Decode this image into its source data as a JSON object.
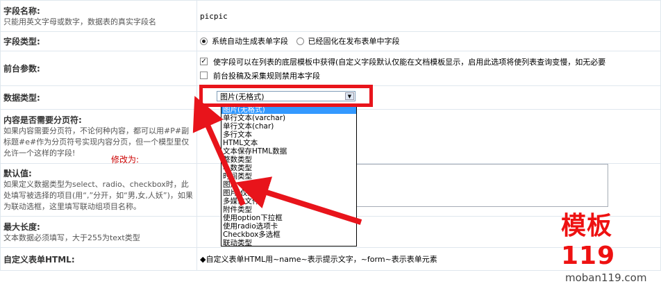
{
  "rows": {
    "field_name": {
      "label": "字段名称:",
      "hint": "只能用英文字母或数字，数据表的真实字段名",
      "value": "picpic"
    },
    "field_type": {
      "label": "字段类型:",
      "option1": "系统自动生成表单字段",
      "option2": "已经固化在发布表单中字段"
    },
    "front_params": {
      "label": "前台参数:",
      "check1": "使字段可以在列表的底层模板中获得(自定义字段默认仅能在文档模板显示，启用此选项将使列表查询变慢，如无必要",
      "check2": "前台投稿及采集规则禁用本字段"
    },
    "data_type": {
      "label": "数据类型:",
      "selected": "图片(无格式)"
    },
    "paging": {
      "label": "内容是否需要分页符:",
      "hint": "如果内容需要分页符，不论何种内容，都可以用#P#副标题#e#作为分页符号实现内容分页，但一个模型里仅允许一个这样的字段!"
    },
    "default": {
      "label": "默认值:",
      "hint": "如果定义数据类型为select、radio、checkbox时，此处填写被选择的项目(用“,”分开，如“男,女,人妖”)，如果为联动选框，这里填写联动组项目名称。"
    },
    "max_length": {
      "label": "最大长度:",
      "hint": "文本数据必须填写，大于255为text类型"
    },
    "custom_html": {
      "label": "自定义表单HTML:",
      "hint": "◆自定义表单HTML用~name~表示提示文字，~form~表示表单元素"
    }
  },
  "annotation": "修改为:",
  "dropdown_options": [
    "图片(无格式)",
    "单行文本(varchar)",
    "单行文本(char)",
    "多行文本",
    "HTML文本",
    "文本保存HTML数据",
    "整数类型",
    "小数类型",
    "时间类型",
    "图片",
    "图片(仅网址)",
    "多媒体文件",
    "附件类型",
    "使用option下拉框",
    "使用radio选项卡",
    "Checkbox多选框",
    "联动类型"
  ],
  "watermark": {
    "mark": "模板119",
    "url": "moban119.com"
  },
  "colors": {
    "highlight": "#e8141b",
    "selected": "#3399ff"
  }
}
